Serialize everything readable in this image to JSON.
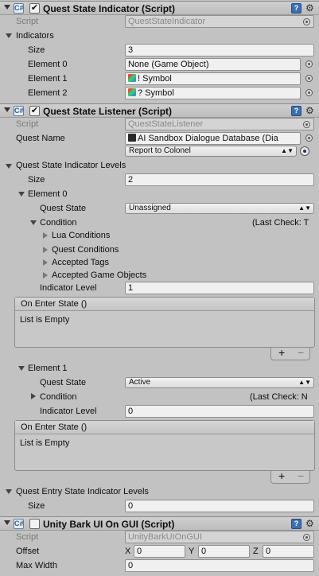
{
  "components": [
    {
      "title": "Quest State Indicator (Script)",
      "enabled_mark": "✔",
      "script_label": "Script",
      "script_value": "QuestStateIndicator",
      "indicators_label": "Indicators",
      "size_label": "Size",
      "size_value": "3",
      "elements": [
        {
          "label": "Element 0",
          "value": "None (Game Object)"
        },
        {
          "label": "Element 1",
          "value": "! Symbol"
        },
        {
          "label": "Element 2",
          "value": "? Symbol"
        }
      ]
    },
    {
      "title": "Quest State Listener (Script)",
      "enabled_mark": "✔",
      "script_label": "Script",
      "script_value": "QuestStateListener",
      "quest_name_label": "Quest Name",
      "quest_name_value": "AI Sandbox Dialogue Database (Dia",
      "quest_select": "Report to Colonel",
      "levels_label": "Quest State Indicator Levels",
      "levels_size_label": "Size",
      "levels_size_value": "2",
      "element0": {
        "label": "Element 0",
        "quest_state_label": "Quest State",
        "quest_state_value": "Unassigned",
        "condition_label": "Condition",
        "last_check": "(Last Check: T",
        "condition_children": [
          "Lua Conditions",
          "Quest Conditions",
          "Accepted Tags",
          "Accepted Game Objects"
        ],
        "indicator_level_label": "Indicator Level",
        "indicator_level_value": "1",
        "event_title": "On Enter State ()",
        "event_empty": "List is Empty"
      },
      "element1": {
        "label": "Element 1",
        "quest_state_label": "Quest State",
        "quest_state_value": "Active",
        "condition_label": "Condition",
        "last_check": "(Last Check: N",
        "indicator_level_label": "Indicator Level",
        "indicator_level_value": "0",
        "event_title": "On Enter State ()",
        "event_empty": "List is Empty"
      },
      "entry_levels_label": "Quest Entry State Indicator Levels",
      "entry_size_label": "Size",
      "entry_size_value": "0"
    },
    {
      "title": "Unity Bark UI On GUI (Script)",
      "enabled_mark": "",
      "script_label": "Script",
      "script_value": "UnityBarkUIOnGUI",
      "offset_label": "Offset",
      "x_label": "X",
      "x_value": "0",
      "y_label": "Y",
      "y_value": "0",
      "z_label": "Z",
      "z_value": "0",
      "max_width_label": "Max Width",
      "max_width_value": "0"
    }
  ],
  "glyphs": {
    "plus": "+",
    "minus": "−",
    "popup_arrows": "▲▼",
    "help": "?",
    "gear": "⚙",
    "script": "C#"
  }
}
